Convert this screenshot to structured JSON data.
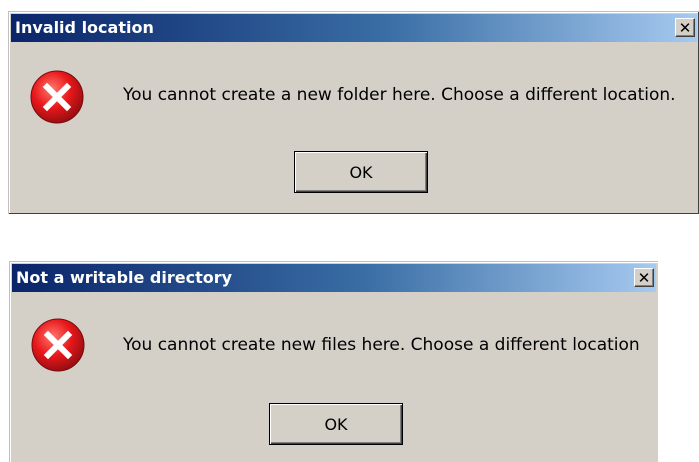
{
  "dialogs": [
    {
      "title": "Invalid location",
      "close_glyph": "✕",
      "message": "You cannot create a new folder here.  Choose a different location.",
      "ok_label": "OK",
      "icon": "error-icon"
    },
    {
      "title": "Not a writable directory",
      "close_glyph": "✕",
      "message": "You cannot create new files here. Choose a different location",
      "ok_label": "OK",
      "icon": "error-icon"
    }
  ],
  "colors": {
    "title_gradient_start": "#0a246a",
    "title_gradient_end": "#a6caf0",
    "dialog_face": "#d4d0c8",
    "error_red": "#e8171b"
  }
}
